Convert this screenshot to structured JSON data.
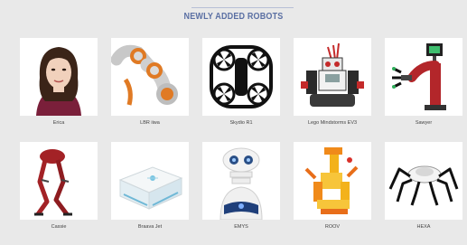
{
  "section": {
    "title": "NEWLY ADDED ROBOTS"
  },
  "robots": [
    {
      "name": "Erica",
      "icon": "erica-robot-image"
    },
    {
      "name": "LBR iiwa",
      "icon": "lbr-iiwa-robot-arm-image"
    },
    {
      "name": "Skydio R1",
      "icon": "skydio-r1-drone-image"
    },
    {
      "name": "Lego Mindstorms EV3",
      "icon": "lego-mindstorms-ev3-image"
    },
    {
      "name": "Sawyer",
      "icon": "sawyer-robot-arm-image"
    },
    {
      "name": "Cassie",
      "icon": "cassie-bipedal-robot-image"
    },
    {
      "name": "Braava Jet",
      "icon": "braava-jet-mop-robot-image"
    },
    {
      "name": "EMYS",
      "icon": "emys-social-robot-image"
    },
    {
      "name": "ROOV",
      "icon": "roov-kit-robot-image"
    },
    {
      "name": "HEXA",
      "icon": "hexa-hexapod-robot-image"
    }
  ]
}
